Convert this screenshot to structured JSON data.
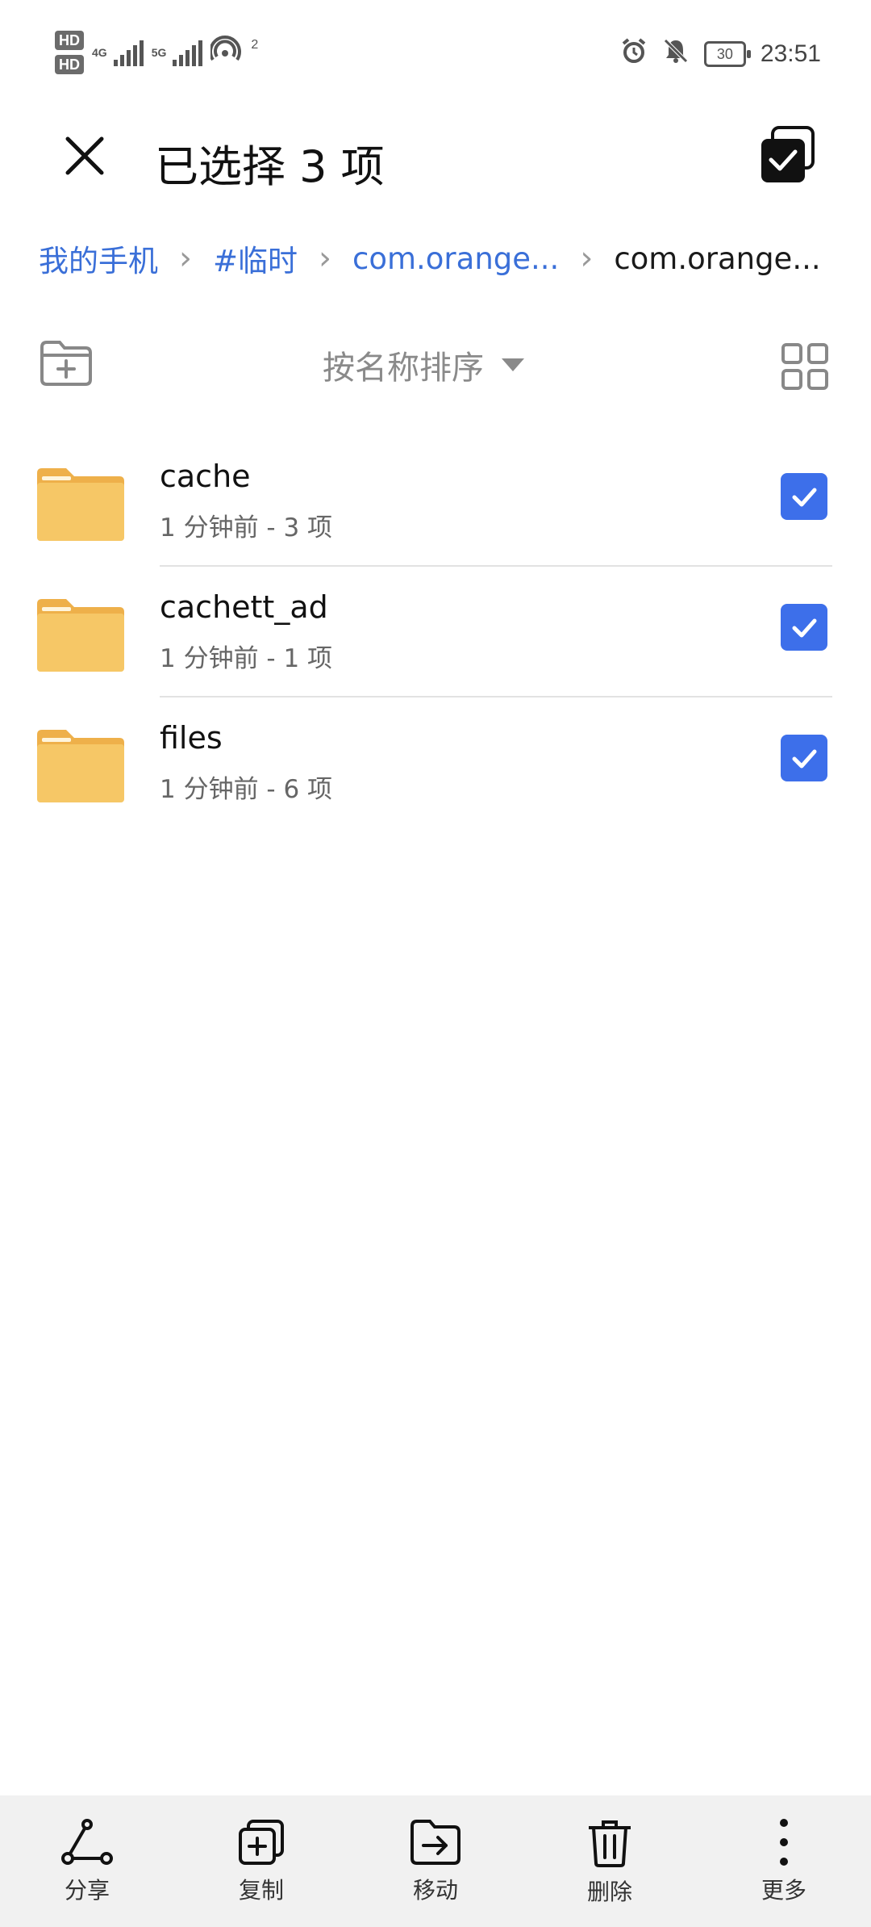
{
  "status_bar": {
    "hd1": "HD",
    "hd2": "HD",
    "net1": "4G",
    "net2": "5G",
    "wifi_badge": "2",
    "battery": "30",
    "time": "23:51"
  },
  "header": {
    "title": "已选择 3 项"
  },
  "breadcrumb": {
    "items": [
      "我的手机",
      "#临时",
      "com.orange...",
      "com.orange..."
    ]
  },
  "toolbar": {
    "sort_label": "按名称排序"
  },
  "files": [
    {
      "name": "cache",
      "meta": "1 分钟前 - 3 项",
      "checked": true
    },
    {
      "name": "cachett_ad",
      "meta": "1 分钟前 - 1 项",
      "checked": true
    },
    {
      "name": "files",
      "meta": "1 分钟前 - 6 项",
      "checked": true
    }
  ],
  "bottom_actions": [
    {
      "label": "分享",
      "icon": "share-icon"
    },
    {
      "label": "复制",
      "icon": "copy-icon"
    },
    {
      "label": "移动",
      "icon": "move-icon"
    },
    {
      "label": "删除",
      "icon": "delete-icon"
    },
    {
      "label": "更多",
      "icon": "more-icon"
    }
  ],
  "colors": {
    "accent": "#3d6fea",
    "breadcrumb_link": "#3a6fd8",
    "folder": "#f6c766",
    "bottom_bar": "#f1f1f1"
  }
}
